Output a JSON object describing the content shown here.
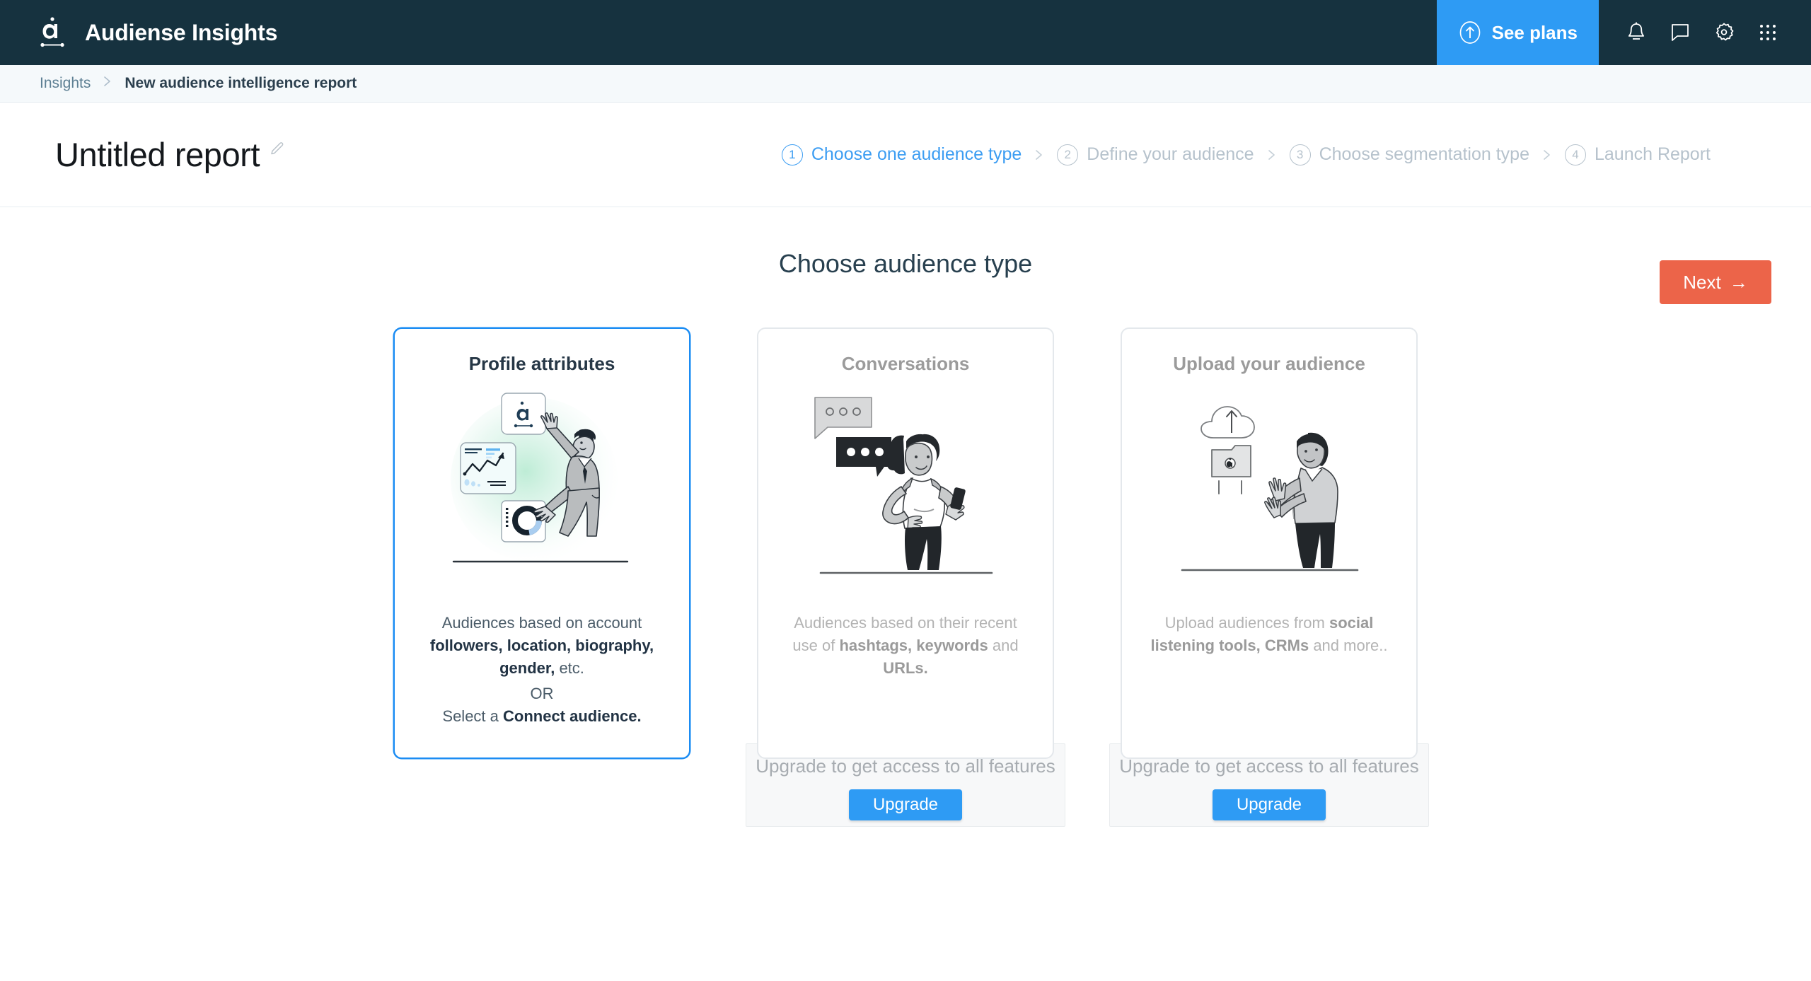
{
  "header": {
    "brand": "Audiense Insights",
    "logo_icon": "audiense-logo-icon",
    "see_plans": {
      "label": "See plans",
      "icon": "arrow-up-circle-icon"
    },
    "icons": [
      {
        "name": "notifications-bell-icon"
      },
      {
        "name": "chat-bubble-icon"
      },
      {
        "name": "settings-gear-icon"
      },
      {
        "name": "apps-grid-icon"
      }
    ],
    "accent_blue": "#2e9bf4",
    "background": "#16323f"
  },
  "breadcrumb": {
    "root": "Insights",
    "separator": "chevron-right-icon",
    "current": "New audience intelligence report"
  },
  "report": {
    "title": "Untitled report",
    "edit_icon": "pencil-edit-icon"
  },
  "steps": [
    {
      "number": "1",
      "label": "Choose one audience type",
      "state": "active"
    },
    {
      "number": "2",
      "label": "Define your audience",
      "state": "inactive"
    },
    {
      "number": "3",
      "label": "Choose segmentation type",
      "state": "inactive"
    },
    {
      "number": "4",
      "label": "Launch Report",
      "state": "inactive"
    }
  ],
  "main": {
    "section_title": "Choose audience type",
    "next_button": {
      "label": "Next",
      "arrow": "→",
      "color": "#ec6449"
    }
  },
  "cards": [
    {
      "title": "Profile attributes",
      "selected": true,
      "illustration": "man-pointing-at-data-cards-illustration",
      "desc": {
        "line1_plain": "Audiences based on account",
        "line2_bold": "followers, location, biography,",
        "line3_bold": "gender,",
        "line3_plain": " etc.",
        "or": "OR",
        "line4_plain": "Select a ",
        "line4_bold": "Connect audience."
      },
      "upgrade": null
    },
    {
      "title": "Conversations",
      "selected": false,
      "illustration": "woman-with-phone-and-speech-bubbles-illustration",
      "desc": {
        "line1_plain": "Audiences based on their recent",
        "line2_plain_a": "use of ",
        "line2_bold": "hashtags, keywords",
        "line2_plain_b": " and",
        "line3_bold": "URLs."
      },
      "upgrade": {
        "text": "Upgrade to get access to all features",
        "button": "Upgrade",
        "button_color": "#2e9bf4"
      }
    },
    {
      "title": "Upload your audience",
      "selected": false,
      "illustration": "man-uploading-files-to-cloud-illustration",
      "desc": {
        "line1_plain": "Upload audiences from ",
        "line1_bold": "social",
        "line2_bold": "listening tools, CRMs",
        "line2_plain": " and more.."
      },
      "upgrade": {
        "text": "Upgrade to get access to all features",
        "button": "Upgrade",
        "button_color": "#2e9bf4"
      }
    }
  ]
}
